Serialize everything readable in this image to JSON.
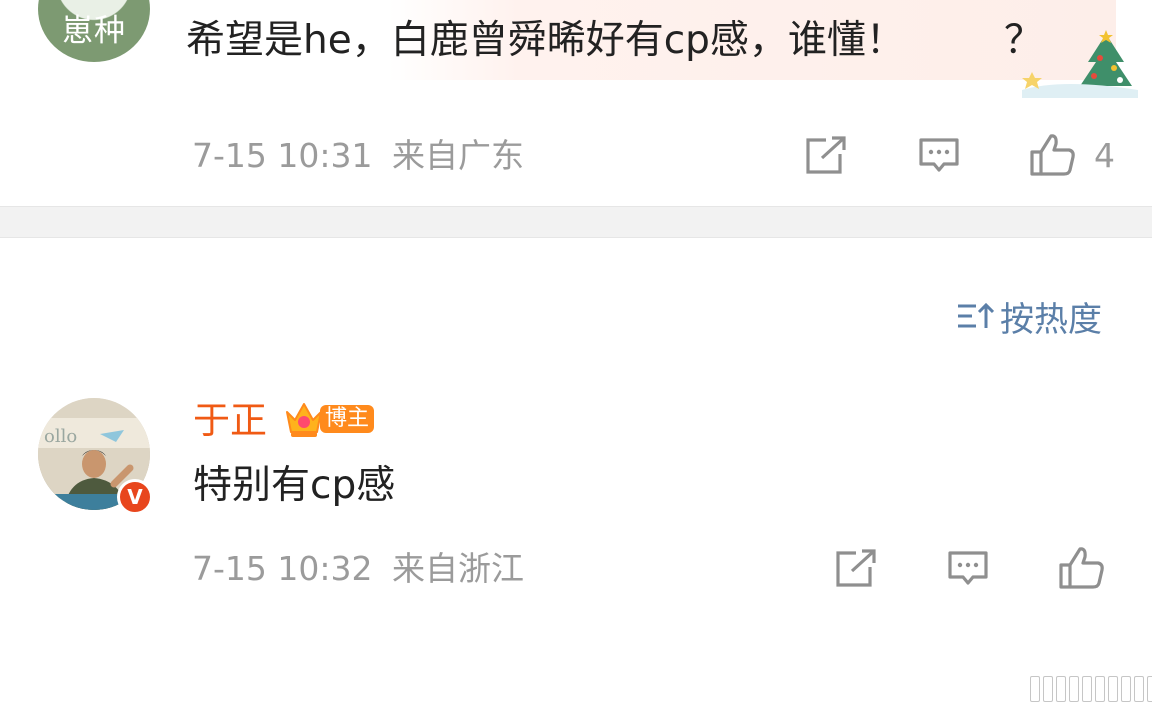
{
  "comment1": {
    "avatar_text": "崽种",
    "text": "希望是he，白鹿曾舜晞好有cp感，谁懂！",
    "text_end": "？",
    "time": "7-15 10:31",
    "location": "来自广东",
    "like_count": "4",
    "icons": [
      "repost-icon",
      "comment-icon",
      "like-icon"
    ]
  },
  "sort": {
    "label": "按热度",
    "icon": "sort-icon",
    "accent": "#5b7fa8"
  },
  "comment2": {
    "name": "于正",
    "name_color": "#f05a14",
    "badge": "博主",
    "badge_color": "#ff8a1c",
    "verified_glyph": "V",
    "text": "特别有cp感",
    "time": "7-15 10:32",
    "location": "来自浙江",
    "icons": [
      "repost-icon",
      "comment-icon",
      "like-icon"
    ]
  }
}
